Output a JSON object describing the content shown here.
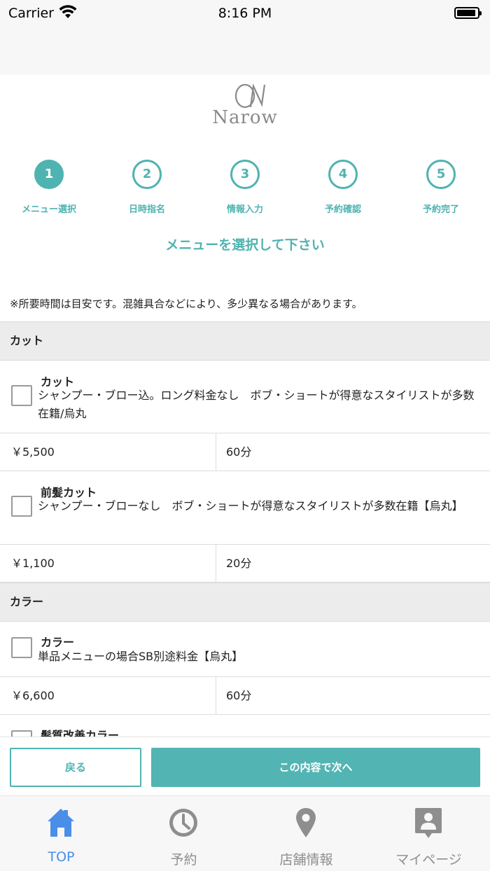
{
  "status_bar": {
    "carrier": "Carrier",
    "time": "8:16 PM"
  },
  "logo": {
    "text": "Narow"
  },
  "steps": [
    {
      "number": "1",
      "label": "メニュー選択",
      "active": true
    },
    {
      "number": "2",
      "label": "日時指名",
      "active": false
    },
    {
      "number": "3",
      "label": "情報入力",
      "active": false
    },
    {
      "number": "4",
      "label": "予約確認",
      "active": false
    },
    {
      "number": "5",
      "label": "予約完了",
      "active": false
    }
  ],
  "heading": "メニューを選択して下さい",
  "note": "※所要時間は目安です。混雑具合などにより、多少異なる場合があります。",
  "categories": [
    {
      "name": "カット",
      "items": [
        {
          "name": "カット",
          "description": "シャンプー・ブロー込。ロング料金なし　ボブ・ショートが得意なスタイリストが多数在籍/烏丸",
          "price": "￥5,500",
          "duration": "60分"
        },
        {
          "name": "前髪カット",
          "description": "シャンプー・ブローなし　ボブ・ショートが得意なスタイリストが多数在籍【烏丸】",
          "price": "￥1,100",
          "duration": "20分"
        }
      ]
    },
    {
      "name": "カラー",
      "items": [
        {
          "name": "カラー",
          "description": "単品メニューの場合SB別途料金【烏丸】",
          "price": "￥6,600",
          "duration": "60分"
        },
        {
          "name": "髪質改善カラー",
          "description": "",
          "price": "",
          "duration": ""
        }
      ]
    }
  ],
  "actions": {
    "back_label": "戻る",
    "next_label": "この内容で次へ"
  },
  "tabs": [
    {
      "label": "TOP",
      "icon": "home-icon",
      "active": true
    },
    {
      "label": "予約",
      "icon": "clock-icon",
      "active": false
    },
    {
      "label": "店舗情報",
      "icon": "location-pin-icon",
      "active": false
    },
    {
      "label": "マイページ",
      "icon": "person-badge-icon",
      "active": false
    }
  ],
  "colors": {
    "accent": "#4fb3b1",
    "tab_active": "#4a8ee8",
    "tab_inactive": "#8e8e8e"
  }
}
